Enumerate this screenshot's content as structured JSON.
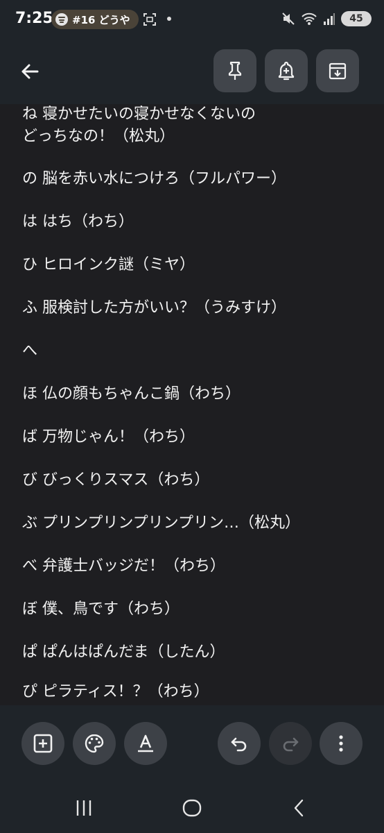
{
  "status_bar": {
    "time": "7:25",
    "now_playing": "#16 どうや",
    "battery": "45",
    "icons": [
      "spotify-icon",
      "screenshot-icon",
      "mute-icon",
      "wifi-icon",
      "signal-icon",
      "battery-icon"
    ]
  },
  "toolbar": {
    "back_icon": "back-arrow-icon",
    "actions": [
      "pin-icon",
      "reminder-bell-icon",
      "archive-icon"
    ]
  },
  "note": {
    "lines": [
      "ね 寝かせたいの寝かせなくないの",
      "どっちなの！（松丸）",
      "の 脳を赤い水につけろ（フルパワー）",
      "は はち（わち）",
      "ひ ヒロインク謎（ミヤ）",
      "ふ 服検討した方がいい？（うみすけ）",
      "へ",
      "ほ 仏の顔もちゃんこ鍋（わち）",
      "ば 万物じゃん！（わち）",
      "び びっくりスマス（わち）",
      "ぶ プリンプリンプリンプリン…（松丸）",
      "べ 弁護士バッジだ！（わち）",
      "ぼ 僕、鳥です（わち）",
      "ぱ ぱんはぱんだま（したん）",
      "ぴ ピラティス！？（わち）"
    ]
  },
  "bottom_bar": {
    "left_actions": [
      "add-box-icon",
      "palette-icon",
      "text-format-icon"
    ],
    "right_actions": [
      "undo-icon",
      "redo-icon",
      "more-vert-icon"
    ]
  },
  "nav": {
    "buttons": [
      "recents-icon",
      "home-icon",
      "back-nav-icon"
    ]
  },
  "colors": {
    "background": "#1e1e21",
    "bar": "#1f2429",
    "button": "#41454b",
    "text": "#f2f2f2"
  }
}
